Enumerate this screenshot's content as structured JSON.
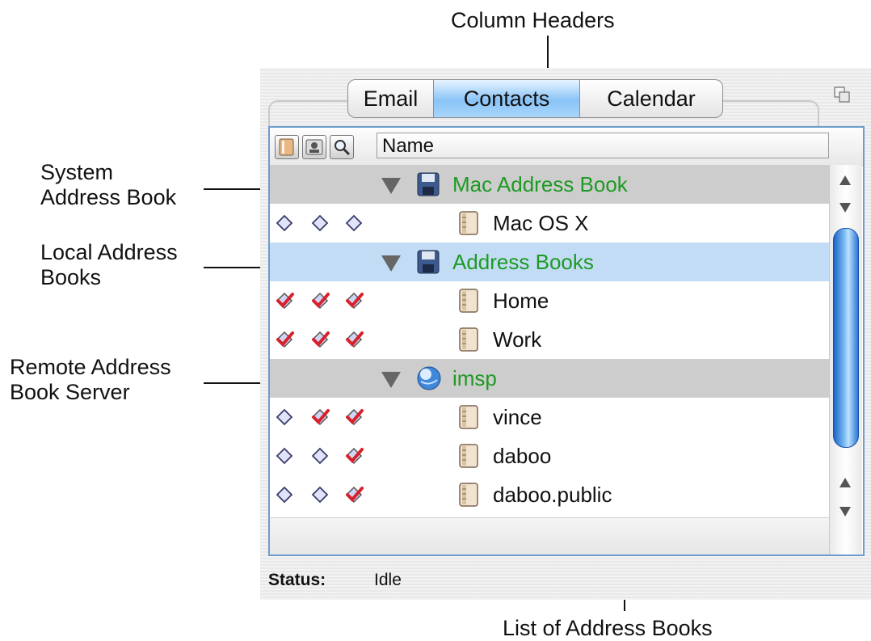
{
  "annotations": {
    "column_headers": "Column Headers",
    "system_line1": "System",
    "system_line2": "Address Book",
    "local_line1": "Local Address",
    "local_line2": "Books",
    "remote_line1": "Remote Address",
    "remote_line2": "Book Server",
    "list_label": "List of Address Books"
  },
  "tabs": [
    "Email",
    "Contacts",
    "Calendar"
  ],
  "active_tab": "Contacts",
  "header": {
    "name_column": "Name"
  },
  "rows": [
    {
      "type": "group",
      "label": "Mac Address Book",
      "icon": "floppy-icon",
      "marks": []
    },
    {
      "type": "item",
      "label": "Mac OS X",
      "icon": "address-book-icon",
      "marks": [
        "diamond",
        "diamond",
        "diamond"
      ]
    },
    {
      "type": "group",
      "label": "Address Books",
      "icon": "floppy-icon",
      "selected": true,
      "marks": []
    },
    {
      "type": "item",
      "label": "Home",
      "icon": "address-book-icon",
      "marks": [
        "check",
        "check",
        "check"
      ]
    },
    {
      "type": "item",
      "label": "Work",
      "icon": "address-book-icon",
      "marks": [
        "check",
        "check",
        "check"
      ]
    },
    {
      "type": "group",
      "label": "imsp",
      "icon": "globe-icon",
      "marks": []
    },
    {
      "type": "item",
      "label": "vince",
      "icon": "address-book-icon",
      "marks": [
        "diamond",
        "check",
        "check"
      ]
    },
    {
      "type": "item",
      "label": "daboo",
      "icon": "address-book-icon",
      "marks": [
        "diamond",
        "diamond",
        "check"
      ]
    },
    {
      "type": "item",
      "label": "daboo.public",
      "icon": "address-book-icon",
      "marks": [
        "diamond",
        "diamond",
        "check"
      ]
    }
  ],
  "status": {
    "label": "Status:",
    "value": "Idle"
  },
  "colors": {
    "group_text": "#1e9a22",
    "selection": "#c2dcf6",
    "accent": "#6e9ccb",
    "check": "#d8212b"
  }
}
